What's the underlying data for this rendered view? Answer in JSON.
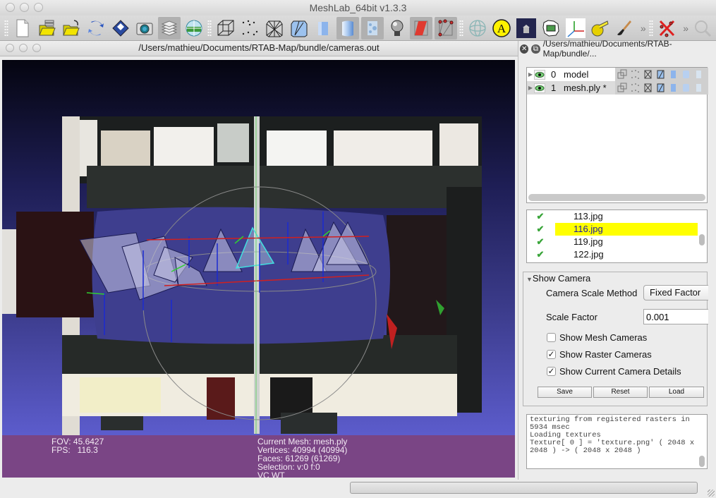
{
  "window": {
    "title": "MeshLab_64bit v1.3.3"
  },
  "toolbar": {
    "buttons": [
      {
        "icon": "new-file-icon",
        "label": "New Project"
      },
      {
        "icon": "open-project-icon",
        "label": "Open Project"
      },
      {
        "icon": "import-mesh-icon",
        "label": "Import Mesh"
      },
      {
        "icon": "reload-icon",
        "label": "Reload"
      },
      {
        "icon": "save-icon",
        "label": "Export Mesh"
      },
      {
        "icon": "snapshot-icon",
        "label": "Save Snapshot"
      },
      {
        "icon": "layers-icon",
        "label": "Show Layer Dialog",
        "active": true
      },
      {
        "icon": "raster-icon",
        "label": "Show Raster"
      },
      {
        "icon": "bbox-icon",
        "label": "Bounding Box"
      },
      {
        "icon": "points-icon",
        "label": "Points"
      },
      {
        "icon": "wireframe-icon",
        "label": "Wireframe"
      },
      {
        "icon": "hidden-lines-icon",
        "label": "Hidden Lines"
      },
      {
        "icon": "flat-icon",
        "label": "Flat"
      },
      {
        "icon": "smooth-icon",
        "label": "Smooth"
      },
      {
        "icon": "texture-icon",
        "label": "Texture"
      },
      {
        "icon": "light-icon",
        "label": "Light",
        "active": true
      },
      {
        "icon": "select-faces-icon",
        "label": "Select Faces"
      },
      {
        "icon": "select-vertices-icon",
        "label": "Select Vertices"
      },
      {
        "icon": "trackball-icon",
        "label": "Trackball"
      },
      {
        "icon": "annotation-icon",
        "label": "A"
      },
      {
        "icon": "scene-icon",
        "label": "Scene"
      },
      {
        "icon": "mesh-filter-icon",
        "label": "Mesh Filter"
      },
      {
        "icon": "axes-icon",
        "label": "Axes"
      },
      {
        "icon": "measure-icon",
        "label": "Measure"
      },
      {
        "icon": "paint-icon",
        "label": "Paint"
      },
      {
        "icon": "delete-selection-icon",
        "label": "Delete Selection"
      },
      {
        "icon": "zoom-icon",
        "label": "Zoom"
      }
    ],
    "overflow_glyph": "»"
  },
  "viewer": {
    "title": "/Users/mathieu/Documents/RTAB-Map/bundle/cameras.out",
    "info_left": [
      "FOV: 45.6427",
      "FPS:   116.3"
    ],
    "info_right": [
      "Current Mesh: mesh.ply",
      "Vertices: 40994 (40994)",
      "Faces: 61269 (61269)",
      "Selection: v:0 f:0",
      "VC WT"
    ]
  },
  "dock": {
    "title": "/Users/mathieu/Documents/RTAB-Map/bundle/...",
    "layers": [
      {
        "index": "0",
        "name": "model",
        "selected": false
      },
      {
        "index": "1",
        "name": "mesh.ply *",
        "selected": true
      }
    ],
    "rasters": [
      {
        "name": "113.jpg",
        "checked": true,
        "selected": false
      },
      {
        "name": "116.jpg",
        "checked": true,
        "selected": true
      },
      {
        "name": "119.jpg",
        "checked": true,
        "selected": false
      },
      {
        "name": "122.jpg",
        "checked": true,
        "selected": false
      }
    ],
    "check_glyph": "✔",
    "camera": {
      "title": "Show Camera",
      "scale_method_label": "Camera Scale Method",
      "scale_method_value": "Fixed Factor",
      "scale_factor_label": "Scale Factor",
      "scale_factor_value": "0.001",
      "show_mesh_cameras": {
        "label": "Show Mesh Cameras",
        "checked": false
      },
      "show_raster_cameras": {
        "label": "Show Raster Cameras",
        "checked": true
      },
      "show_current_details": {
        "label": "Show Current Camera Details",
        "checked": true
      },
      "save_label": "Save",
      "reset_label": "Reset",
      "load_label": "Load"
    },
    "log": [
      "texturing from registered rasters in",
      "5934 msec",
      "Loading textures",
      "Texture[ 0 ] = 'texture.png' ( 2048 x",
      "2048 ) -> ( 2048 x 2048 )"
    ]
  },
  "status": {
    "progress": 0
  }
}
